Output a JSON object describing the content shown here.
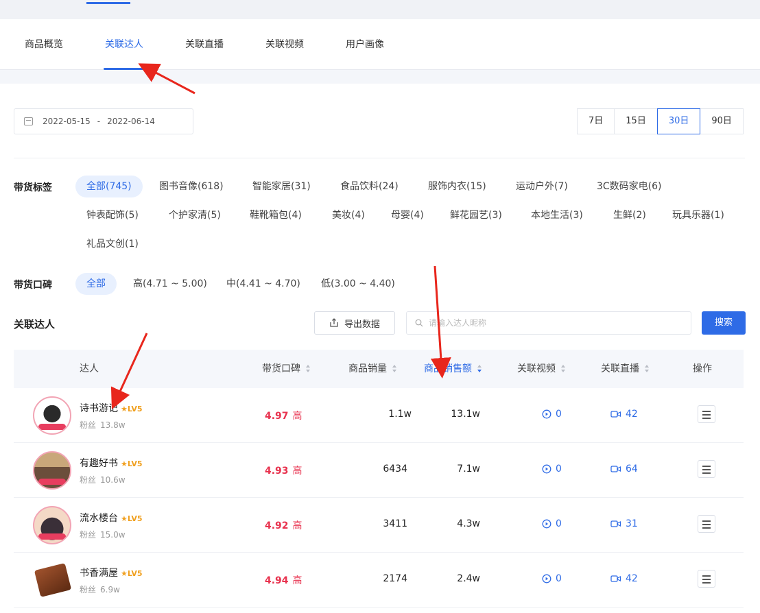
{
  "tabs": [
    {
      "label": "商品概览"
    },
    {
      "label": "关联达人"
    },
    {
      "label": "关联直播"
    },
    {
      "label": "关联视频"
    },
    {
      "label": "用户画像"
    }
  ],
  "date_range": {
    "start": "2022-05-15",
    "sep": "-",
    "end": "2022-06-14"
  },
  "periods": [
    {
      "label": "7日"
    },
    {
      "label": "15日"
    },
    {
      "label": "30日"
    },
    {
      "label": "90日"
    }
  ],
  "category_filter": {
    "label": "带货标签",
    "chips": [
      {
        "label": "全部(745)"
      },
      {
        "label": "图书音像(618)"
      },
      {
        "label": "智能家居(31)"
      },
      {
        "label": "食品饮料(24)"
      },
      {
        "label": "服饰内衣(15)"
      },
      {
        "label": "运动户外(7)"
      },
      {
        "label": "3C数码家电(6)"
      },
      {
        "label": "钟表配饰(5)"
      },
      {
        "label": "个护家清(5)"
      },
      {
        "label": "鞋靴箱包(4)"
      },
      {
        "label": "美妆(4)"
      },
      {
        "label": "母婴(4)"
      },
      {
        "label": "鲜花园艺(3)"
      },
      {
        "label": "本地生活(3)"
      },
      {
        "label": "生鲜(2)"
      },
      {
        "label": "玩具乐器(1)"
      },
      {
        "label": "礼品文创(1)"
      }
    ]
  },
  "reputation_filter": {
    "label": "带货口碑",
    "chips": [
      {
        "label": "全部"
      },
      {
        "label": "高(4.71 ~ 5.00)"
      },
      {
        "label": "中(4.41 ~ 4.70)"
      },
      {
        "label": "低(3.00 ~ 4.40)"
      }
    ]
  },
  "section": {
    "title": "关联达人",
    "export_label": "导出数据",
    "search_placeholder": "请输入达人昵称",
    "search_label": "搜索"
  },
  "table": {
    "columns": {
      "influencer": "达人",
      "reputation": "带货口碑",
      "sales_volume": "商品销量",
      "sales_amount": "商品销售额",
      "videos": "关联视频",
      "lives": "关联直播",
      "action": "操作"
    },
    "rows": [
      {
        "name": "诗书游记",
        "level": "LV5",
        "fans_label": "粉丝",
        "fans": "13.8w",
        "score": "4.97",
        "score_level": "高",
        "sales_volume": "1.1w",
        "sales_amount": "13.1w",
        "videos": "0",
        "lives": "42"
      },
      {
        "name": "有趣好书",
        "level": "LV5",
        "fans_label": "粉丝",
        "fans": "10.6w",
        "score": "4.93",
        "score_level": "高",
        "sales_volume": "6434",
        "sales_amount": "7.1w",
        "videos": "0",
        "lives": "64"
      },
      {
        "name": "流水楼台",
        "level": "LV5",
        "fans_label": "粉丝",
        "fans": "15.0w",
        "score": "4.92",
        "score_level": "高",
        "sales_volume": "3411",
        "sales_amount": "4.3w",
        "videos": "0",
        "lives": "31"
      },
      {
        "name": "书香满屋",
        "level": "LV5",
        "fans_label": "粉丝",
        "fans": "6.9w",
        "score": "4.94",
        "score_level": "高",
        "sales_volume": "2174",
        "sales_amount": "2.4w",
        "videos": "0",
        "lives": "42"
      }
    ]
  },
  "colors": {
    "accent": "#2e6be6",
    "score_red": "#e8334f",
    "annotation_red": "#e8261c"
  }
}
